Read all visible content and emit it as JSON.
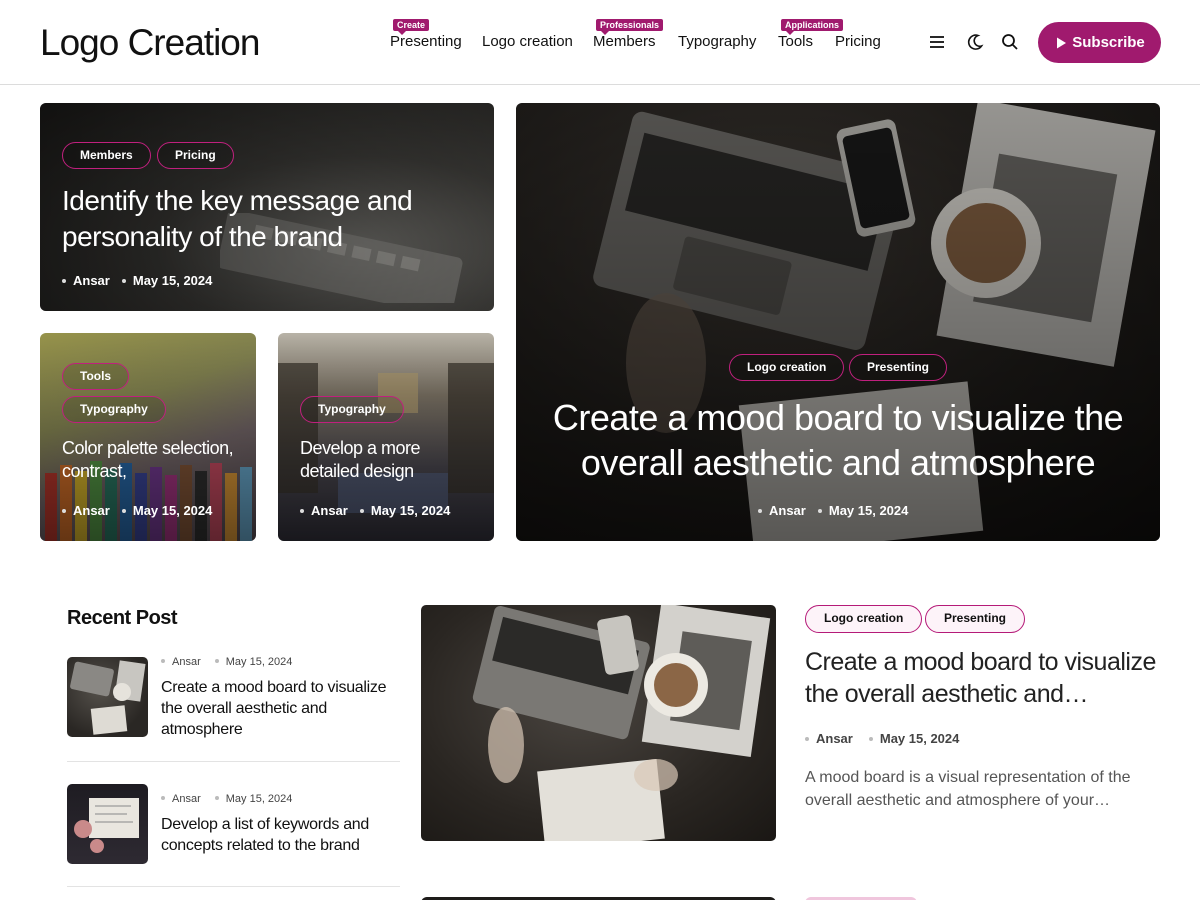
{
  "site": {
    "logo": "Logo Creation",
    "nav": [
      {
        "label": "Presenting",
        "badge": "Create"
      },
      {
        "label": "Logo creation",
        "badge": ""
      },
      {
        "label": "Members",
        "badge": "Professionals"
      },
      {
        "label": "Typography",
        "badge": ""
      },
      {
        "label": "Tools",
        "badge": "Applications"
      },
      {
        "label": "Pricing",
        "badge": ""
      }
    ],
    "icons": [
      "menu-icon",
      "moon-icon",
      "search-icon",
      "play-icon"
    ],
    "subscribe_label": "Subscribe",
    "accent": "#a01a6e"
  },
  "hero": {
    "top_left": {
      "tags": [
        "Members",
        "Pricing"
      ],
      "title": "Identify the key message and personality of the brand",
      "author": "Ansar",
      "date": "May 15, 2024"
    },
    "small_left": {
      "tags": [
        "Tools",
        "Typography"
      ],
      "title": "Color palette selection, contrast,",
      "author": "Ansar",
      "date": "May 15, 2024"
    },
    "small_right": {
      "tags": [
        "Typography"
      ],
      "title": "Develop a more detailed design",
      "author": "Ansar",
      "date": "May 15, 2024"
    },
    "big": {
      "tags": [
        "Logo creation",
        "Presenting"
      ],
      "title": "Create a mood board to visualize the overall aesthetic and atmosphere",
      "author": "Ansar",
      "date": "May 15, 2024"
    }
  },
  "recent": {
    "heading": "Recent Post",
    "posts": [
      {
        "author": "Ansar",
        "date": "May 15, 2024",
        "title": "Create a mood board to visualize the overall aesthetic and atmosphere"
      },
      {
        "author": "Ansar",
        "date": "May 15, 2024",
        "title": "Develop a list of keywords and concepts related to the brand"
      }
    ]
  },
  "feature": {
    "tags": [
      "Logo creation",
      "Presenting"
    ],
    "title": "Create a mood board to visualize the overall aesthetic and…",
    "author": "Ansar",
    "date": "May 15, 2024",
    "excerpt": "A mood board is a visual representation of the overall aesthetic and atmosphere of your…"
  }
}
